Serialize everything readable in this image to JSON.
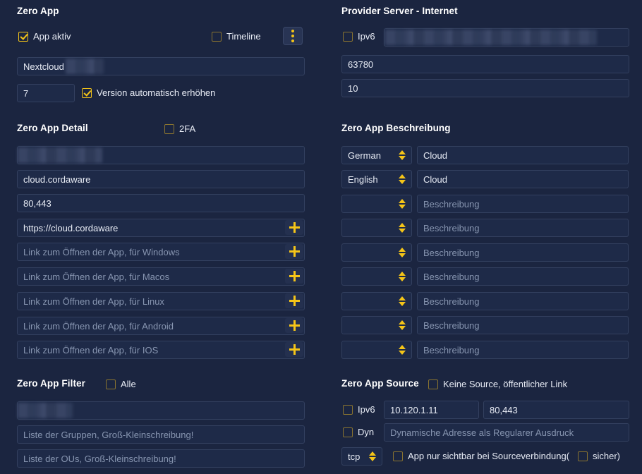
{
  "left": {
    "zero_app": {
      "title": "Zero App",
      "app_active_label": "App aktiv",
      "timeline_label": "Timeline",
      "menu_icon": "kebab-menu-icon",
      "name_value": "Nextcloud",
      "version_value": "7",
      "auto_version_label": "Version automatisch erhöhen"
    },
    "zero_app_detail": {
      "title": "Zero App Detail",
      "twofa_label": "2FA",
      "host_value": "cloud.cordaware",
      "ports_value": "80,443",
      "url_value": "https://cloud.cordaware",
      "link_placeholders": [
        "Link zum Öffnen der App, für Windows",
        "Link zum Öffnen der App, für Macos",
        "Link zum Öffnen der App, für Linux",
        "Link zum Öffnen der App, für Android",
        "Link zum Öffnen der App, für IOS"
      ]
    },
    "zero_app_filter": {
      "title": "Zero App Filter",
      "all_label": "Alle",
      "groups_placeholder": "Liste der Gruppen, Groß-Kleinschreibung!",
      "ous_placeholder": "Liste der OUs, Groß-Kleinschreibung!"
    }
  },
  "right": {
    "provider_server": {
      "title": "Provider Server - Internet",
      "ipv6_label": "Ipv6",
      "port_value": "63780",
      "count_value": "10"
    },
    "zero_app_beschreibung": {
      "title": "Zero App Beschreibung",
      "rows": [
        {
          "lang": "German",
          "text": "Cloud",
          "is_placeholder": false
        },
        {
          "lang": "English",
          "text": "Cloud",
          "is_placeholder": false
        },
        {
          "lang": "",
          "text": "Beschreibung",
          "is_placeholder": true
        },
        {
          "lang": "",
          "text": "Beschreibung",
          "is_placeholder": true
        },
        {
          "lang": "",
          "text": "Beschreibung",
          "is_placeholder": true
        },
        {
          "lang": "",
          "text": "Beschreibung",
          "is_placeholder": true
        },
        {
          "lang": "",
          "text": "Beschreibung",
          "is_placeholder": true
        },
        {
          "lang": "",
          "text": "Beschreibung",
          "is_placeholder": true
        },
        {
          "lang": "",
          "text": "Beschreibung",
          "is_placeholder": true
        }
      ]
    },
    "zero_app_source": {
      "title": "Zero App Source",
      "no_source_label": "Keine Source, öffentlicher Link",
      "ipv6_label": "Ipv6",
      "address_value": "10.120.1.11",
      "ports_value": "80,443",
      "dyn_label": "Dyn",
      "dyn_placeholder": "Dynamische Adresse als Regularer Ausdruck",
      "protocol_value": "tcp",
      "visible_only_label": "App nur sichtbar bei Sourceverbindung(",
      "secure_label": "sicher)"
    }
  },
  "colors": {
    "background": "#1b2540",
    "accent": "#f5c518",
    "field_bg": "#1e2a48",
    "field_border": "#33405f",
    "text": "#e8ecf5",
    "placeholder": "#8795b0"
  }
}
